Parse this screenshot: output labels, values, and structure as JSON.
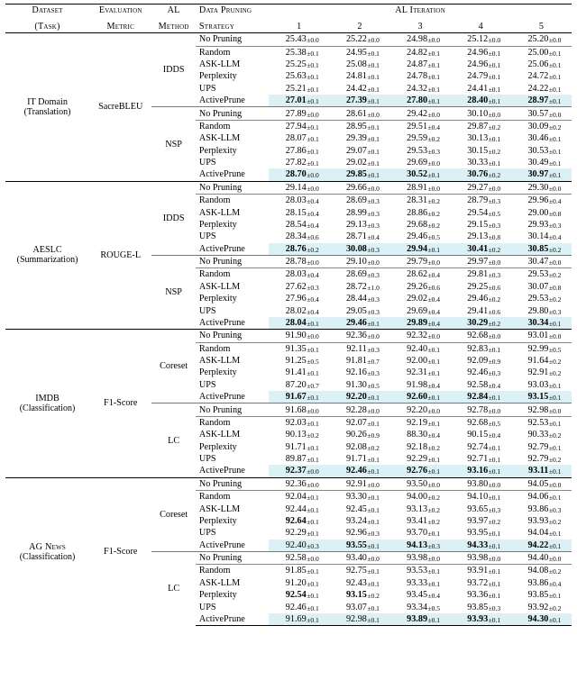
{
  "header": {
    "dataset": "Dataset",
    "task": "(Task)",
    "metric_l1": "Evaluation",
    "metric_l2": "Metric",
    "al_l1": "AL",
    "al_l2": "Method",
    "prune_l1": "Data Pruning",
    "prune_l2": "Strategy",
    "iter_title": "AL Iteration",
    "iters": [
      "1",
      "2",
      "3",
      "4",
      "5"
    ]
  },
  "strategies_full": [
    "No Pruning",
    "Random",
    "ASK-LLM",
    "Perplexity",
    "UPS",
    "ActivePrune"
  ],
  "datasets": [
    {
      "name": "IT Domain",
      "task": "(Translation)",
      "metric": "SacreBLEU",
      "al": [
        {
          "name": "IDDS",
          "rows": [
            {
              "mean": [
                "25.43",
                "25.22",
                "24.98",
                "25.12",
                "25.20"
              ],
              "sd": [
                "0.0",
                "0.0",
                "0.0",
                "0.0",
                "0.0"
              ]
            },
            {
              "mean": [
                "25.38",
                "24.95",
                "24.82",
                "24.96",
                "25.00"
              ],
              "sd": [
                "0.1",
                "0.1",
                "0.1",
                "0.1",
                "0.1"
              ]
            },
            {
              "mean": [
                "25.25",
                "25.08",
                "24.87",
                "24.96",
                "25.06"
              ],
              "sd": [
                "0.1",
                "0.1",
                "0.1",
                "0.1",
                "0.1"
              ]
            },
            {
              "mean": [
                "25.63",
                "24.81",
                "24.78",
                "24.79",
                "24.72"
              ],
              "sd": [
                "0.1",
                "0.1",
                "0.1",
                "0.1",
                "0.1"
              ]
            },
            {
              "mean": [
                "25.21",
                "24.42",
                "24.32",
                "24.41",
                "24.22"
              ],
              "sd": [
                "0.1",
                "0.1",
                "0.1",
                "0.1",
                "0.1"
              ]
            },
            {
              "mean": [
                "27.01",
                "27.39",
                "27.80",
                "28.40",
                "28.97"
              ],
              "sd": [
                "0.1",
                "0.1",
                "0.1",
                "0.1",
                "0.1"
              ],
              "bold": true,
              "hl": true
            }
          ]
        },
        {
          "name": "NSP",
          "rows": [
            {
              "mean": [
                "27.89",
                "28.61",
                "29.42",
                "30.10",
                "30.57"
              ],
              "sd": [
                "0.0",
                "0.0",
                "0.0",
                "0.0",
                "0.0"
              ]
            },
            {
              "mean": [
                "27.94",
                "28.95",
                "29.51",
                "29.87",
                "30.09"
              ],
              "sd": [
                "0.1",
                "0.1",
                "0.4",
                "0.2",
                "0.2"
              ]
            },
            {
              "mean": [
                "28.07",
                "29.39",
                "29.59",
                "30.13",
                "30.46"
              ],
              "sd": [
                "0.1",
                "0.1",
                "0.2",
                "0.1",
                "0.1"
              ]
            },
            {
              "mean": [
                "27.86",
                "29.07",
                "29.53",
                "30.15",
                "30.53"
              ],
              "sd": [
                "0.1",
                "0.1",
                "0.3",
                "0.2",
                "0.1"
              ]
            },
            {
              "mean": [
                "27.82",
                "29.02",
                "29.69",
                "30.33",
                "30.49"
              ],
              "sd": [
                "0.1",
                "0.1",
                "0.0",
                "0.1",
                "0.1"
              ]
            },
            {
              "mean": [
                "28.70",
                "29.85",
                "30.52",
                "30.76",
                "30.97"
              ],
              "sd": [
                "0.0",
                "0.1",
                "0.1",
                "0.2",
                "0.1"
              ],
              "bold": true,
              "hl": true
            }
          ]
        }
      ]
    },
    {
      "name": "AESLC",
      "task": "(Summarization)",
      "metric": "ROUGE-L",
      "al": [
        {
          "name": "IDDS",
          "rows": [
            {
              "mean": [
                "29.14",
                "29.66",
                "28.91",
                "29.27",
                "29.30"
              ],
              "sd": [
                "0.0",
                "0.0",
                "0.0",
                "0.0",
                "0.0"
              ]
            },
            {
              "mean": [
                "28.03",
                "28.69",
                "28.31",
                "28.79",
                "29.96"
              ],
              "sd": [
                "0.4",
                "0.3",
                "0.2",
                "0.3",
                "0.4"
              ]
            },
            {
              "mean": [
                "28.15",
                "28.99",
                "28.86",
                "29.54",
                "29.00"
              ],
              "sd": [
                "0.4",
                "0.3",
                "0.2",
                "0.5",
                "0.8"
              ]
            },
            {
              "mean": [
                "28.54",
                "29.13",
                "29.68",
                "29.15",
                "29.93"
              ],
              "sd": [
                "0.4",
                "0.3",
                "0.2",
                "0.3",
                "0.3"
              ]
            },
            {
              "mean": [
                "28.34",
                "28.71",
                "29.46",
                "29.13",
                "30.14"
              ],
              "sd": [
                "0.6",
                "0.4",
                "0.5",
                "0.8",
                "0.4"
              ]
            },
            {
              "mean": [
                "28.76",
                "30.08",
                "29.94",
                "30.41",
                "30.85"
              ],
              "sd": [
                "0.2",
                "0.3",
                "0.1",
                "0.2",
                "0.2"
              ],
              "bold": true,
              "hl": true
            }
          ]
        },
        {
          "name": "NSP",
          "rows": [
            {
              "mean": [
                "28.78",
                "29.10",
                "29.79",
                "29.97",
                "30.47"
              ],
              "sd": [
                "0.0",
                "0.0",
                "0.0",
                "0.0",
                "0.0"
              ]
            },
            {
              "mean": [
                "28.03",
                "28.69",
                "28.62",
                "29.81",
                "29.53"
              ],
              "sd": [
                "0.4",
                "0.3",
                "0.4",
                "0.3",
                "0.2"
              ]
            },
            {
              "mean": [
                "27.62",
                "28.72",
                "29.26",
                "29.25",
                "30.07"
              ],
              "sd": [
                "0.3",
                "1.0",
                "0.6",
                "0.6",
                "0.8"
              ]
            },
            {
              "mean": [
                "27.96",
                "28.44",
                "29.02",
                "29.46",
                "29.53"
              ],
              "sd": [
                "0.4",
                "0.3",
                "0.4",
                "0.2",
                "0.2"
              ]
            },
            {
              "mean": [
                "28.02",
                "29.05",
                "29.69",
                "29.41",
                "29.80"
              ],
              "sd": [
                "0.4",
                "0.3",
                "0.4",
                "0.6",
                "0.3"
              ]
            },
            {
              "mean": [
                "28.04",
                "29.46",
                "29.89",
                "30.29",
                "30.34"
              ],
              "sd": [
                "0.1",
                "0.1",
                "0.4",
                "0.2",
                "0.1"
              ],
              "bold": true,
              "hl": true
            }
          ]
        }
      ]
    },
    {
      "name": "IMDB",
      "task": "(Classification)",
      "metric": "F1-Score",
      "al": [
        {
          "name": "Coreset",
          "rows": [
            {
              "mean": [
                "91.90",
                "92.36",
                "92.32",
                "92.68",
                "93.01"
              ],
              "sd": [
                "0.0",
                "0.0",
                "0.0",
                "0.0",
                "0.0"
              ]
            },
            {
              "mean": [
                "91.35",
                "92.11",
                "92.40",
                "92.83",
                "92.99"
              ],
              "sd": [
                "0.1",
                "0.3",
                "0.1",
                "0.1",
                "0.5"
              ]
            },
            {
              "mean": [
                "91.25",
                "91.81",
                "92.00",
                "92.09",
                "91.64"
              ],
              "sd": [
                "0.5",
                "0.7",
                "0.1",
                "0.9",
                "0.2"
              ]
            },
            {
              "mean": [
                "91.41",
                "92.16",
                "92.31",
                "92.46",
                "92.91"
              ],
              "sd": [
                "0.1",
                "0.3",
                "0.1",
                "0.3",
                "0.2"
              ]
            },
            {
              "mean": [
                "87.20",
                "91.30",
                "91.98",
                "92.58",
                "93.03"
              ],
              "sd": [
                "0.7",
                "0.5",
                "0.4",
                "0.4",
                "0.1"
              ]
            },
            {
              "mean": [
                "91.67",
                "92.20",
                "92.60",
                "92.84",
                "93.15"
              ],
              "sd": [
                "0.1",
                "0.1",
                "0.1",
                "0.1",
                "0.1"
              ],
              "bold": true,
              "hl": true
            }
          ]
        },
        {
          "name": "LC",
          "rows": [
            {
              "mean": [
                "91.68",
                "92.28",
                "92.20",
                "92.78",
                "92.98"
              ],
              "sd": [
                "0.0",
                "0.0",
                "0.0",
                "0.0",
                "0.0"
              ]
            },
            {
              "mean": [
                "92.03",
                "92.07",
                "92.19",
                "92.68",
                "92.53"
              ],
              "sd": [
                "0.1",
                "0.1",
                "0.1",
                "0.5",
                "0.1"
              ]
            },
            {
              "mean": [
                "90.13",
                "90.26",
                "88.30",
                "90.15",
                "90.33"
              ],
              "sd": [
                "0.2",
                "0.9",
                "0.4",
                "0.4",
                "0.2"
              ]
            },
            {
              "mean": [
                "91.71",
                "92.08",
                "92.18",
                "92.74",
                "92.79"
              ],
              "sd": [
                "0.1",
                "0.2",
                "0.2",
                "0.1",
                "0.1"
              ]
            },
            {
              "mean": [
                "89.87",
                "91.71",
                "92.29",
                "92.71",
                "92.79"
              ],
              "sd": [
                "0.1",
                "0.1",
                "0.1",
                "0.1",
                "0.2"
              ]
            },
            {
              "mean": [
                "92.37",
                "92.46",
                "92.76",
                "93.16",
                "93.11"
              ],
              "sd": [
                "0.0",
                "0.1",
                "0.1",
                "0.1",
                "0.1"
              ],
              "bold": true,
              "hl": true
            }
          ]
        }
      ]
    },
    {
      "name_sc": "AG News",
      "task": "(Classification)",
      "metric": "F1-Score",
      "al": [
        {
          "name": "Coreset",
          "rows": [
            {
              "mean": [
                "92.36",
                "92.91",
                "93.50",
                "93.80",
                "94.05"
              ],
              "sd": [
                "0.0",
                "0.0",
                "0.0",
                "0.0",
                "0.0"
              ]
            },
            {
              "mean": [
                "92.04",
                "93.30",
                "94.00",
                "94.10",
                "94.06"
              ],
              "sd": [
                "0.1",
                "0.1",
                "0.2",
                "0.1",
                "0.1"
              ]
            },
            {
              "mean": [
                "92.44",
                "92.45",
                "93.13",
                "93.65",
                "93.86"
              ],
              "sd": [
                "0.1",
                "0.1",
                "0.2",
                "0.3",
                "0.3"
              ]
            },
            {
              "mean": [
                "92.64",
                "93.24",
                "93.41",
                "93.97",
                "93.93"
              ],
              "sd": [
                "0.1",
                "0.1",
                "0.2",
                "0.2",
                "0.2"
              ],
              "bold_i": [
                0
              ]
            },
            {
              "mean": [
                "92.29",
                "92.96",
                "93.70",
                "93.95",
                "94.04"
              ],
              "sd": [
                "0.1",
                "0.3",
                "0.1",
                "0.1",
                "0.1"
              ]
            },
            {
              "mean": [
                "92.40",
                "93.55",
                "94.13",
                "94.33",
                "94.22"
              ],
              "sd": [
                "0.3",
                "0.1",
                "0.3",
                "0.1",
                "0.1"
              ],
              "bold_i": [
                1,
                2,
                3,
                4
              ],
              "hl": true
            }
          ]
        },
        {
          "name": "LC",
          "rows": [
            {
              "mean": [
                "92.58",
                "93.40",
                "93.98",
                "93.98",
                "94.40"
              ],
              "sd": [
                "0.0",
                "0.0",
                "0.0",
                "0.0",
                "0.0"
              ]
            },
            {
              "mean": [
                "91.85",
                "92.75",
                "93.53",
                "93.91",
                "94.08"
              ],
              "sd": [
                "0.1",
                "0.1",
                "0.1",
                "0.1",
                "0.2"
              ]
            },
            {
              "mean": [
                "91.20",
                "92.43",
                "93.33",
                "93.72",
                "93.86"
              ],
              "sd": [
                "0.1",
                "0.1",
                "0.1",
                "0.1",
                "0.4"
              ]
            },
            {
              "mean": [
                "92.54",
                "93.15",
                "93.45",
                "93.36",
                "93.85"
              ],
              "sd": [
                "0.1",
                "0.2",
                "0.4",
                "0.1",
                "0.1"
              ],
              "bold_i": [
                0,
                1
              ]
            },
            {
              "mean": [
                "92.46",
                "93.07",
                "93.34",
                "93.85",
                "93.92"
              ],
              "sd": [
                "0.1",
                "0.1",
                "0.5",
                "0.3",
                "0.2"
              ]
            },
            {
              "mean": [
                "91.69",
                "92.98",
                "93.89",
                "93.93",
                "94.30"
              ],
              "sd": [
                "0.1",
                "0.1",
                "0.1",
                "0.1",
                "0.1"
              ],
              "bold_i": [
                2,
                3,
                4
              ],
              "hl": true
            }
          ]
        }
      ]
    }
  ]
}
